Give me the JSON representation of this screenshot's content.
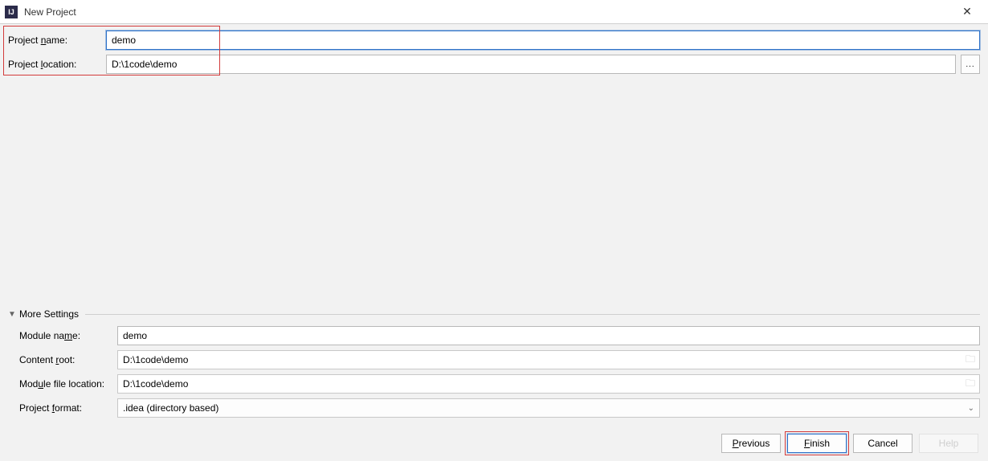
{
  "window": {
    "title": "New Project",
    "icon_text": "IJ"
  },
  "form": {
    "project_name_label": "Project name:",
    "project_name_value": "demo",
    "project_location_label": "Project location:",
    "project_location_value": "D:\\1code\\demo",
    "browse_button": "..."
  },
  "more": {
    "header": "More Settings",
    "module_name_label": "Module name:",
    "module_name_value": "demo",
    "content_root_label": "Content root:",
    "content_root_value": "D:\\1code\\demo",
    "module_file_location_label": "Module file location:",
    "module_file_location_value": "D:\\1code\\demo",
    "project_format_label": "Project format:",
    "project_format_value": ".idea (directory based)"
  },
  "buttons": {
    "previous": "Previous",
    "finish": "Finish",
    "cancel": "Cancel",
    "help": "Help"
  }
}
